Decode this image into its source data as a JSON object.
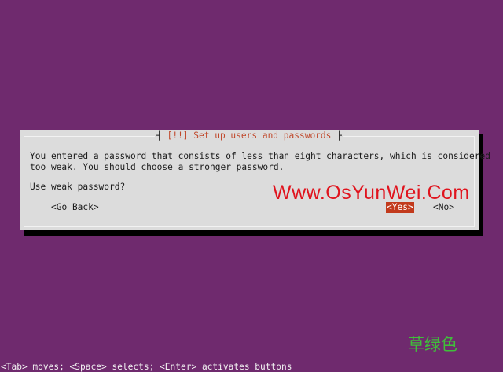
{
  "dialog": {
    "title_open": "┤",
    "title": " [!!] Set up users and passwords ",
    "title_close": "├",
    "message_lines": [
      "You entered a password that consists of less than eight characters, which is considered",
      "too weak. You should choose a stronger password."
    ],
    "question": "Use weak password?",
    "buttons": {
      "go_back": "<Go Back>",
      "yes": "<Yes>",
      "no": "<No>"
    },
    "selected_button": "yes"
  },
  "overlay": {
    "watermark": "Www.OsYunWei.Com",
    "stamp": "草绿色"
  },
  "status_bar": {
    "hint": "<Tab> moves; <Space> selects; <Enter> activates buttons"
  },
  "colors": {
    "background": "#6f2a6e",
    "dialog": "#dcdcdc",
    "title": "#c0482b",
    "selected": "#c23a1c",
    "watermark": "#e0141e",
    "stamp": "#3fbf3a"
  }
}
